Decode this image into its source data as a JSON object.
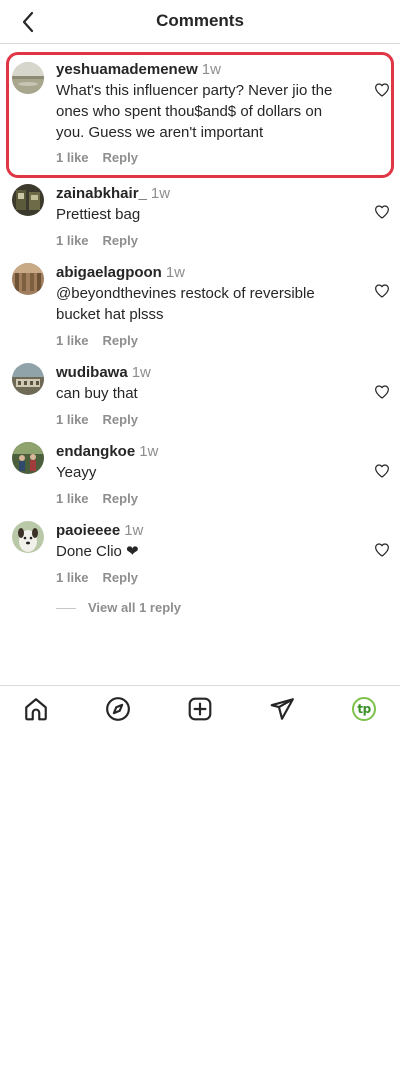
{
  "header": {
    "title": "Comments",
    "back_icon": "chevron-left-icon"
  },
  "comments": [
    {
      "username": "yeshuamademenew",
      "time": "1w",
      "text": "What's this influencer party? Never jio the ones who spent thou$and$ of dollars on you. Guess we aren't important",
      "likes": "1 like",
      "reply": "Reply",
      "avatar": "landscape-avatar"
    },
    {
      "username": "zainabkhair_",
      "time": "1w",
      "text": "Prettiest bag",
      "likes": "1 like",
      "reply": "Reply",
      "avatar": "train-avatar"
    },
    {
      "username": "abigaelagpoon",
      "time": "1w",
      "text": "@beyondthevines restock of reversible bucket hat plsss",
      "likes": "1 like",
      "reply": "Reply",
      "avatar": "interior-avatar"
    },
    {
      "username": "wudibawa",
      "time": "1w",
      "text": "can buy that",
      "likes": "1 like",
      "reply": "Reply",
      "avatar": "building-avatar"
    },
    {
      "username": "endangkoe",
      "time": "1w",
      "text": "Yeayy",
      "likes": "1 like",
      "reply": "Reply",
      "avatar": "people-avatar"
    },
    {
      "username": "paoieeee",
      "time": "1w",
      "text": "Done Clio ❤",
      "likes": "1 like",
      "reply": "Reply",
      "avatar": "dog-avatar"
    }
  ],
  "view_replies": "View all 1 reply",
  "bottom_nav": {
    "items": [
      "home-icon",
      "explore-icon",
      "create-icon",
      "direct-icon",
      "profile-icon"
    ],
    "profile_initials": "tp"
  },
  "colors": {
    "highlight": "#e03545",
    "text": "#262626",
    "secondary": "#8e8e8e",
    "profile_accent": "#7cc24a"
  }
}
